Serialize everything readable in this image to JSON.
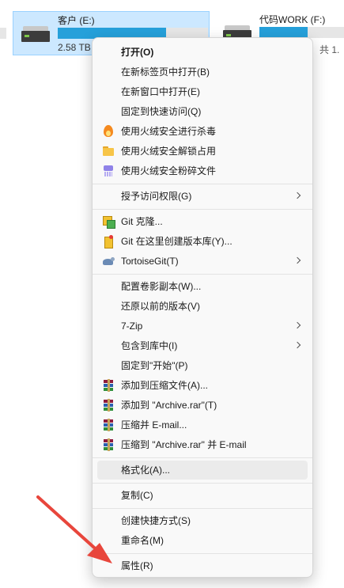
{
  "explorer": {
    "drives": [
      {
        "name": "客户 (E:)",
        "size_text": "2.58 TB",
        "used_fraction": 0.72,
        "selected": true
      },
      {
        "name": "代码WORK (F:)",
        "used_fraction": 0.55,
        "selected": false
      }
    ],
    "status_partial": "，共 1."
  },
  "context_menu": {
    "items": [
      {
        "label": "打开(O)",
        "bold": true
      },
      {
        "label": "在新标签页中打开(B)"
      },
      {
        "label": "在新窗口中打开(E)"
      },
      {
        "label": "固定到快速访问(Q)"
      },
      {
        "label": "使用火绒安全进行杀毒",
        "icon": "huorong-fire-icon"
      },
      {
        "label": "使用火绒安全解锁占用",
        "icon": "folder-unlock-icon"
      },
      {
        "label": "使用火绒安全粉碎文件",
        "icon": "shredder-icon"
      },
      {
        "label": "授予访问权限(G)",
        "submenu": true
      },
      {
        "label": "Git 克隆...",
        "icon": "git-clone-icon"
      },
      {
        "label": "Git 在这里创建版本库(Y)...",
        "icon": "git-create-repo-icon"
      },
      {
        "label": "TortoiseGit(T)",
        "icon": "tortoisegit-icon",
        "submenu": true
      },
      {
        "label": "配置卷影副本(W)..."
      },
      {
        "label": "还原以前的版本(V)"
      },
      {
        "label": "7-Zip",
        "submenu": true
      },
      {
        "label": "包含到库中(I)",
        "submenu": true
      },
      {
        "label": "固定到\"开始\"(P)"
      },
      {
        "label": "添加到压缩文件(A)...",
        "icon": "winrar-icon"
      },
      {
        "label": "添加到 \"Archive.rar\"(T)",
        "icon": "winrar-icon"
      },
      {
        "label": "压缩并 E-mail...",
        "icon": "winrar-icon"
      },
      {
        "label": "压缩到 \"Archive.rar\" 并 E-mail",
        "icon": "winrar-icon"
      },
      {
        "label": "格式化(A)...",
        "hovered": true
      },
      {
        "label": "复制(C)"
      },
      {
        "label": "创建快捷方式(S)"
      },
      {
        "label": "重命名(M)"
      },
      {
        "label": "属性(R)"
      }
    ]
  },
  "annotation": {
    "arrow_color": "#e8463c",
    "target": "属性(R)"
  },
  "colors": {
    "selection_bg": "#cce8ff",
    "drive_bar_fill": "#26a0da",
    "menu_hover": "#ebebeb"
  }
}
